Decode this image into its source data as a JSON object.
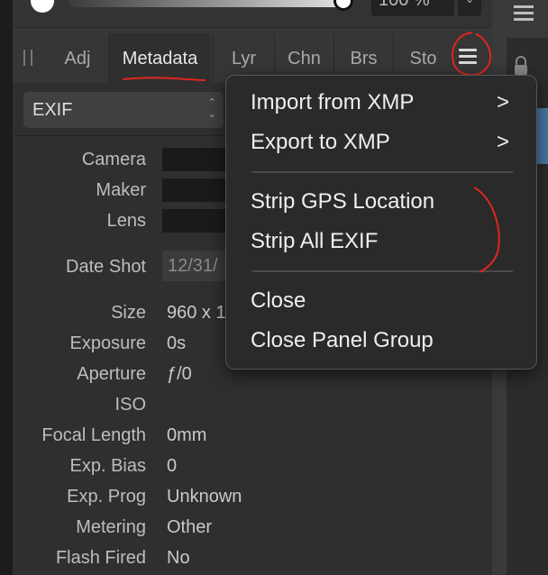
{
  "toolbar": {
    "zoom_value": "100 %",
    "zoom_dropdown_icon": "chevron-down-icon"
  },
  "tabs": [
    {
      "label": "Adj"
    },
    {
      "label": "Metadata"
    },
    {
      "label": "Lyr"
    },
    {
      "label": "Chn"
    },
    {
      "label": "Brs"
    },
    {
      "label": "Sto"
    }
  ],
  "active_tab": "Metadata",
  "metadata_type_select": {
    "value": "EXIF"
  },
  "fields": {
    "camera": {
      "label": "Camera"
    },
    "maker": {
      "label": "Maker"
    },
    "lens": {
      "label": "Lens"
    },
    "date_shot": {
      "label": "Date Shot",
      "value": "12/31/"
    },
    "size": {
      "label": "Size",
      "value": "960 x 1"
    },
    "exposure": {
      "label": "Exposure",
      "value": "0s"
    },
    "aperture": {
      "label": "Aperture",
      "value": "ƒ/0"
    },
    "iso": {
      "label": "ISO",
      "value": ""
    },
    "focal_length": {
      "label": "Focal Length",
      "value": "0mm"
    },
    "exp_bias": {
      "label": "Exp. Bias",
      "value": "0"
    },
    "exp_prog": {
      "label": "Exp. Prog",
      "value": "Unknown"
    },
    "metering": {
      "label": "Metering",
      "value": "Other"
    },
    "flash_fired": {
      "label": "Flash Fired",
      "value": "No"
    }
  },
  "panel_menu": {
    "import_xmp": "Import from XMP",
    "export_xmp": "Export to XMP",
    "strip_gps": "Strip GPS Location",
    "strip_exif": "Strip All EXIF",
    "close": "Close",
    "close_group": "Close Panel Group",
    "submenu_chevron": ">"
  },
  "colors": {
    "panel_bg": "#2f2f2f",
    "menu_bg": "#2a2a2a",
    "annotation_red": "#e0261f",
    "accent_blue": "#4a78a6"
  }
}
